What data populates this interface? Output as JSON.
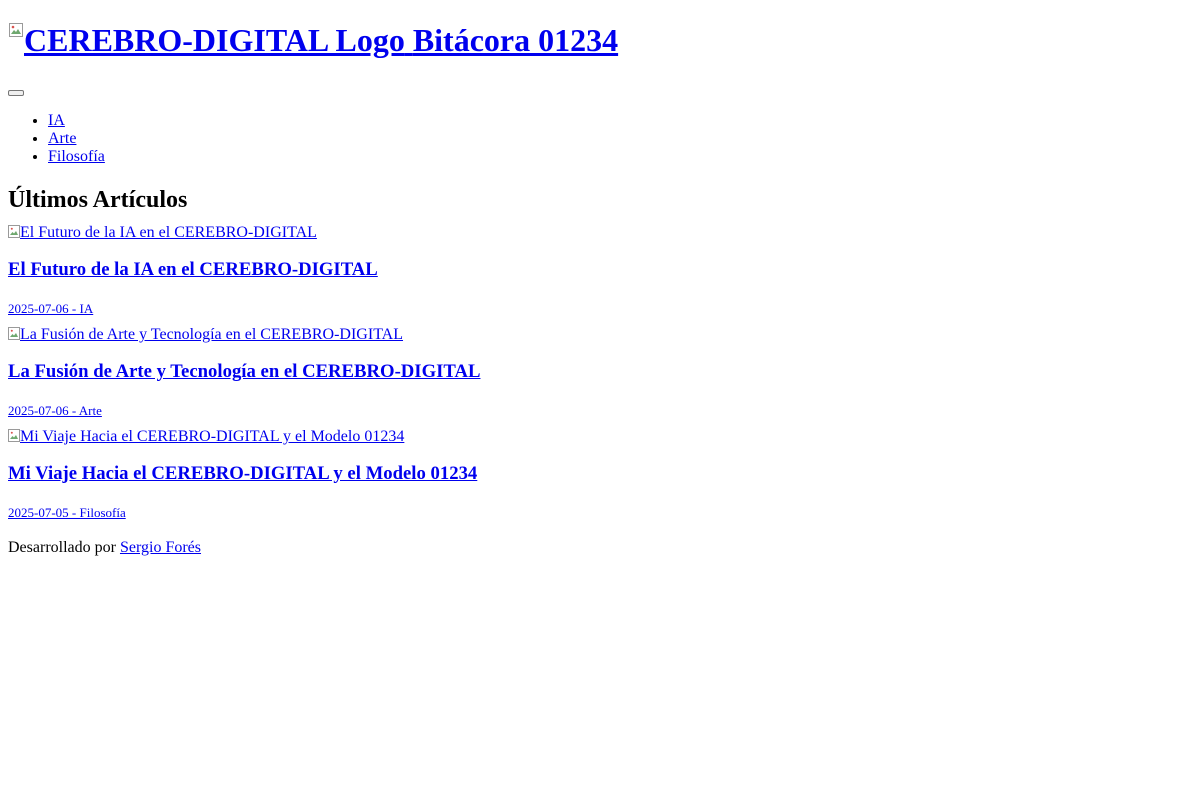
{
  "header": {
    "logo_alt": "CEREBRO-DIGITAL Logo",
    "title": "Bitácora 01234",
    "menu_toggle_label": ""
  },
  "nav": {
    "items": [
      {
        "label": "IA"
      },
      {
        "label": "Arte"
      },
      {
        "label": "Filosofía"
      }
    ]
  },
  "main": {
    "section_title": "Últimos Artículos",
    "articles": [
      {
        "image_alt": "El Futuro de la IA en el CEREBRO-DIGITAL",
        "title": "El Futuro de la IA en el CEREBRO-DIGITAL",
        "meta": "2025-07-06 - IA"
      },
      {
        "image_alt": "La Fusión de Arte y Tecnología en el CEREBRO-DIGITAL",
        "title": "La Fusión de Arte y Tecnología en el CEREBRO-DIGITAL",
        "meta": "2025-07-06 - Arte"
      },
      {
        "image_alt": "Mi Viaje Hacia el CEREBRO-DIGITAL y el Modelo 01234",
        "title": "Mi Viaje Hacia el CEREBRO-DIGITAL y el Modelo 01234",
        "meta": "2025-07-05 - Filosofía"
      }
    ]
  },
  "footer": {
    "prefix": "Desarrollado por",
    "author": "Sergio Forés"
  },
  "icons": {
    "broken_image": "broken-image-icon"
  },
  "colors": {
    "link": "#0000ee",
    "text": "#000000",
    "background": "#ffffff"
  }
}
